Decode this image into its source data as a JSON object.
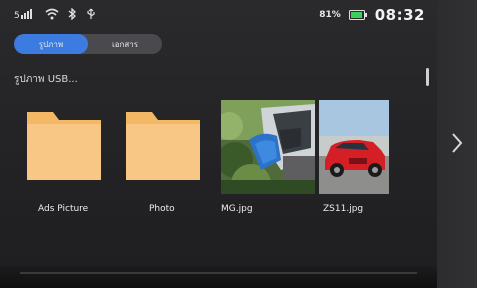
{
  "status_bar": {
    "icons": [
      "signal-icon",
      "wifi-icon",
      "bluetooth-icon",
      "usb-icon"
    ],
    "battery_percent": "81%",
    "time": "08:32"
  },
  "tabs": [
    {
      "label": "รูปภาพ",
      "active": true
    },
    {
      "label": "เอกสาร",
      "active": false
    }
  ],
  "breadcrumb": "รูปภาพ USB...",
  "files": [
    {
      "name": "Ads Picture",
      "type": "folder"
    },
    {
      "name": "Photo",
      "type": "folder"
    },
    {
      "name": "MG.jpg",
      "type": "image"
    },
    {
      "name": "ZS11.jpg",
      "type": "image"
    }
  ],
  "colors": {
    "accent": "#3c7ce0",
    "folder": "#f5c27d",
    "battery": "#38d15a"
  }
}
